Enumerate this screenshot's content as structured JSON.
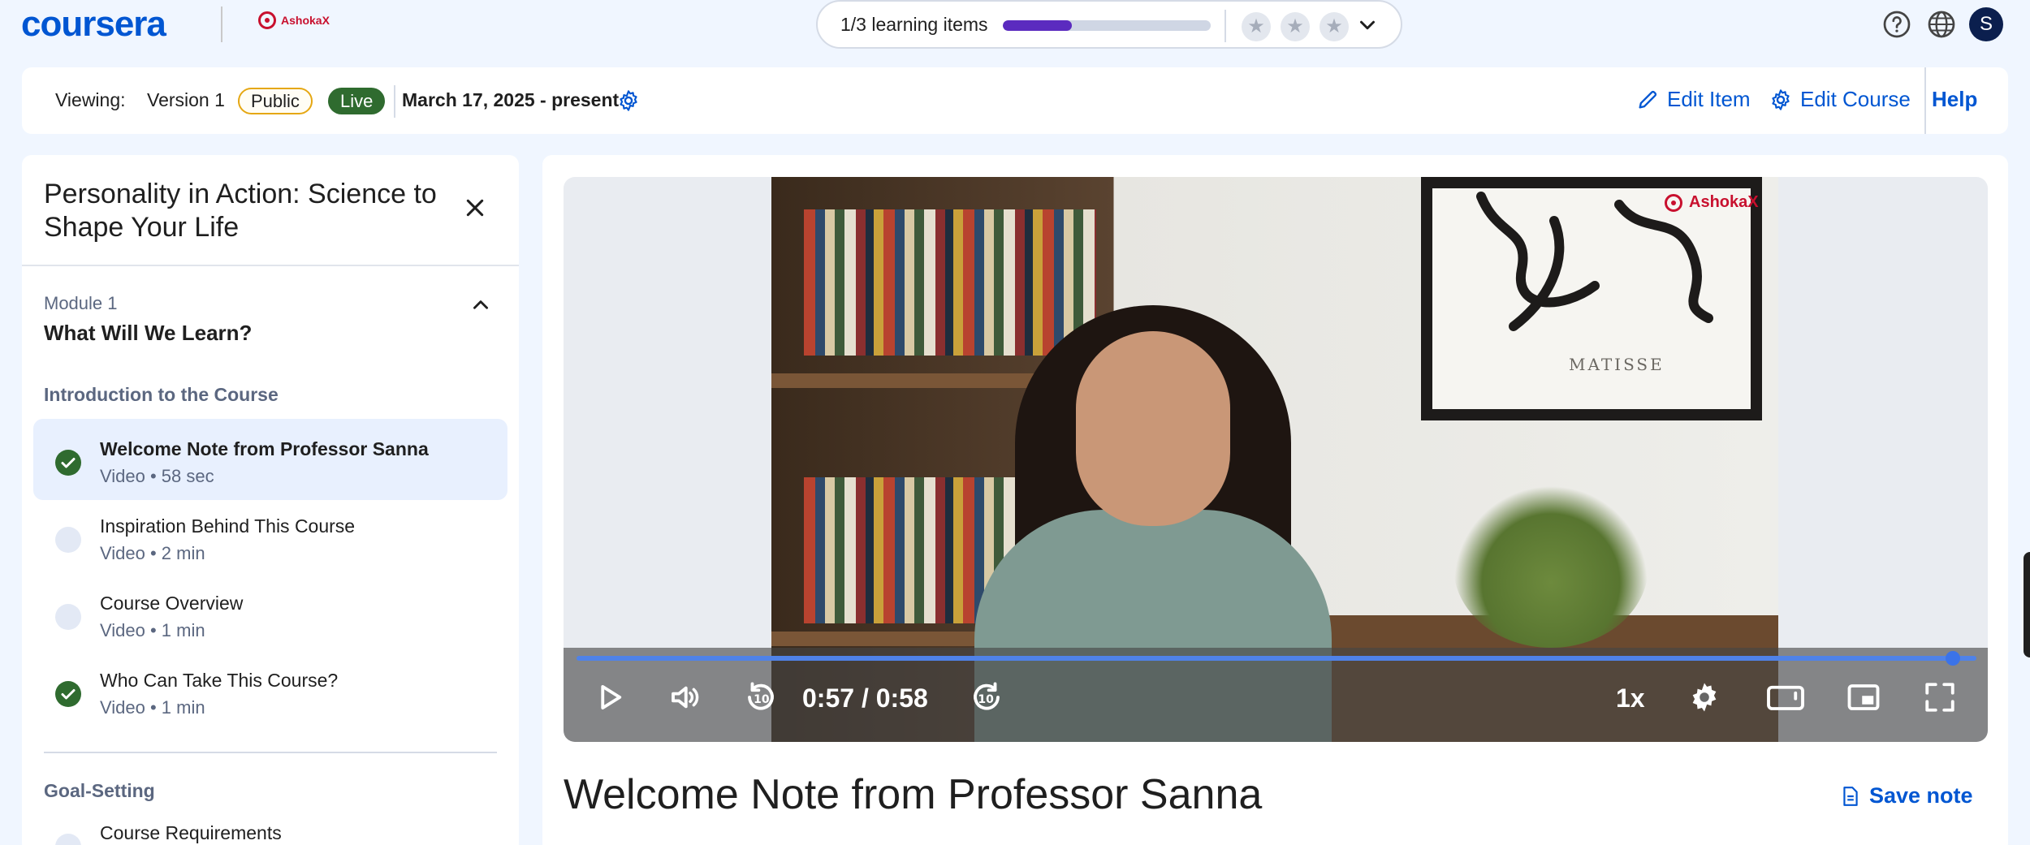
{
  "header": {
    "brand": "coursera",
    "partner": "AshokaX",
    "progress": {
      "text": "1/3 learning items",
      "fraction": 0.333
    },
    "rating_stars": 3,
    "avatar_initial": "S"
  },
  "version_bar": {
    "viewing_label": "Viewing:",
    "version": "Version 1",
    "visibility": "Public",
    "status": "Live",
    "date_range": "March 17, 2025 - present",
    "edit_item": "Edit Item",
    "edit_course": "Edit Course",
    "help": "Help"
  },
  "sidebar": {
    "course_title": "Personality in Action: Science to Shape Your Life",
    "module": {
      "label": "Module 1",
      "title": "What Will We Learn?"
    },
    "sections": [
      {
        "label": "Introduction to the Course",
        "items": [
          {
            "title": "Welcome Note from Professor Sanna",
            "meta": "Video • 58 sec",
            "completed": true,
            "active": true
          },
          {
            "title": "Inspiration Behind This Course",
            "meta": "Video • 2 min",
            "completed": false,
            "active": false
          },
          {
            "title": "Course Overview",
            "meta": "Video • 1 min",
            "completed": false,
            "active": false
          },
          {
            "title": "Who Can Take This Course?",
            "meta": "Video • 1 min",
            "completed": true,
            "active": false
          }
        ]
      },
      {
        "label": "Goal-Setting",
        "items": [
          {
            "title": "Course Requirements",
            "meta": "",
            "completed": false,
            "active": false
          }
        ]
      }
    ]
  },
  "player": {
    "time": "0:57 / 0:58",
    "played_fraction": 0.983,
    "speed": "1x",
    "watermark": "AshokaX",
    "painting_caption": "MATISSE"
  },
  "lesson": {
    "title": "Welcome Note from Professor Sanna",
    "save_note": "Save note"
  },
  "colors": {
    "brand_blue": "#0056d2",
    "progress_purple": "#5b2bbf",
    "live_green": "#2f6b2f",
    "public_border": "#e5a713",
    "page_bg": "#f0f6ff"
  }
}
